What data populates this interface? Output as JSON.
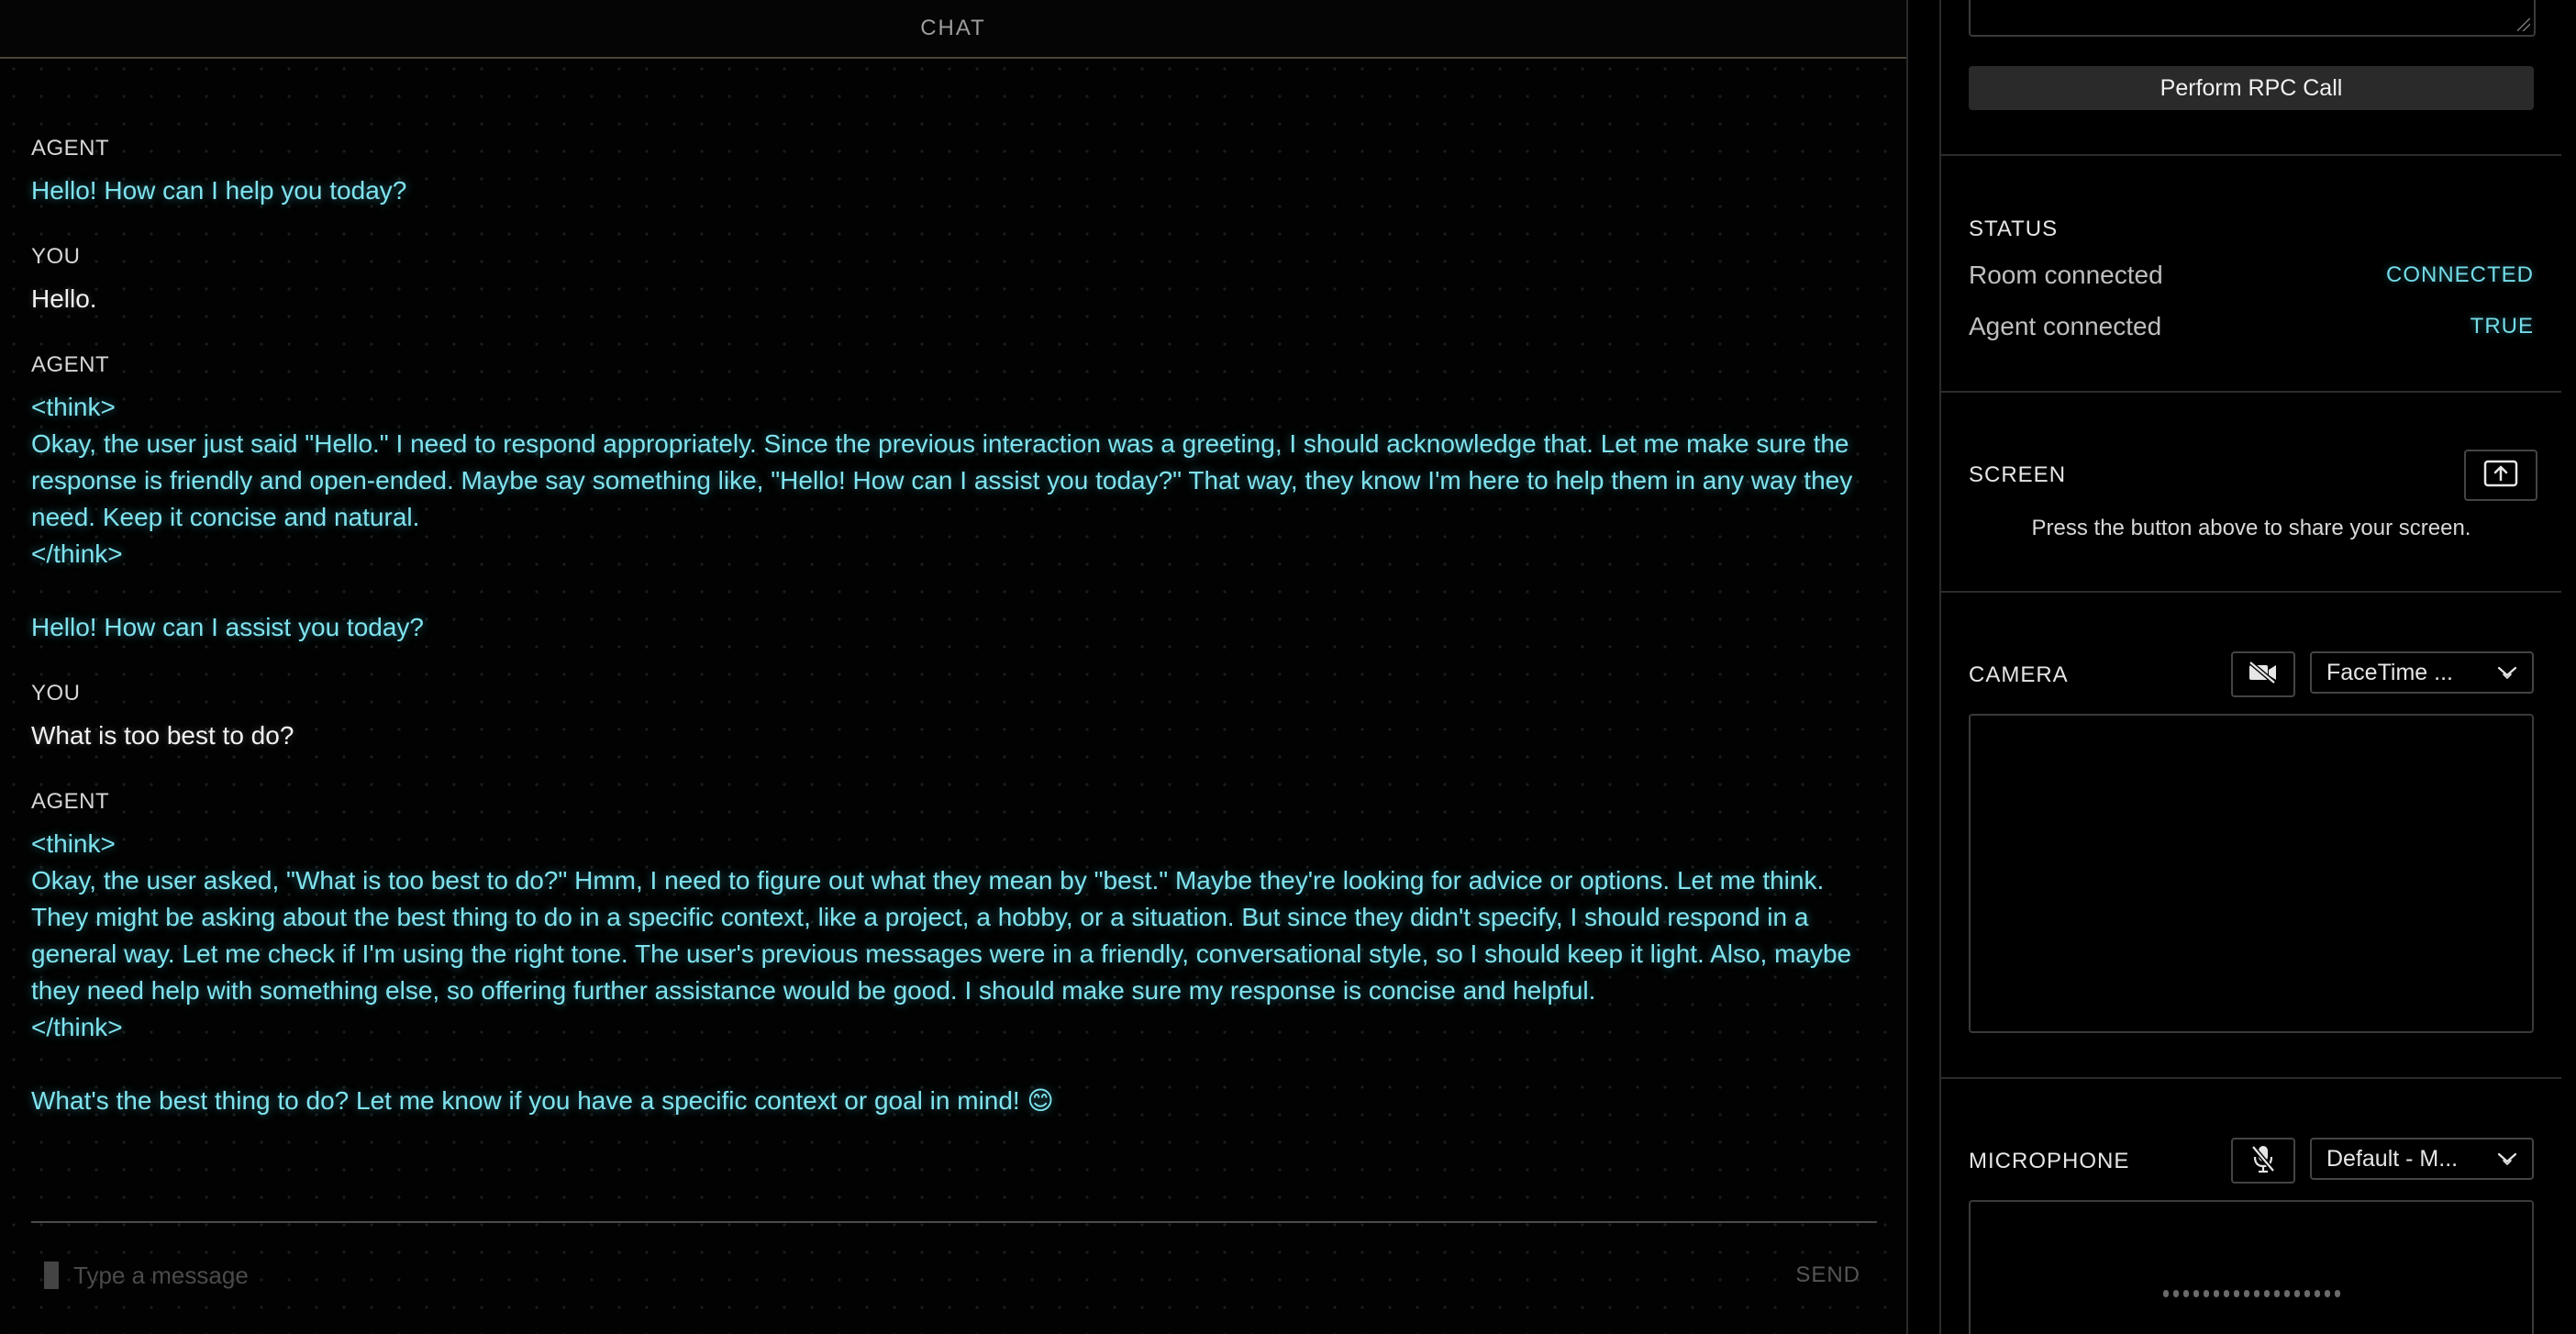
{
  "chat": {
    "header": "CHAT",
    "messages": [
      {
        "role": "agent",
        "name": "AGENT",
        "text": "Hello! How can I help you today?"
      },
      {
        "role": "you",
        "name": "YOU",
        "text": "Hello."
      },
      {
        "role": "agent",
        "name": "AGENT",
        "text": "<think>\nOkay, the user just said \"Hello.\" I need to respond appropriately. Since the previous interaction was a greeting, I should acknowledge that. Let me make sure the response is friendly and open-ended. Maybe say something like, \"Hello! How can I assist you today?\" That way, they know I'm here to help them in any way they need. Keep it concise and natural.\n</think>\n\nHello! How can I assist you today?"
      },
      {
        "role": "you",
        "name": "YOU",
        "text": "What is too best to do?"
      },
      {
        "role": "agent",
        "name": "AGENT",
        "text": "<think>\nOkay, the user asked, \"What is too best to do?\" Hmm, I need to figure out what they mean by \"best.\" Maybe they're looking for advice or options. Let me think. They might be asking about the best thing to do in a specific context, like a project, a hobby, or a situation. But since they didn't specify, I should respond in a general way. Let me check if I'm using the right tone. The user's previous messages were in a friendly, conversational style, so I should keep it light. Also, maybe they need help with something else, so offering further assistance would be good. I should make sure my response is concise and helpful.\n</think>\n\nWhat's the best thing to do? Let me know if you have a specific context or goal in mind! 😊"
      }
    ],
    "input_placeholder": "Type a message",
    "send_label": "SEND"
  },
  "rpc": {
    "button_label": "Perform RPC Call"
  },
  "status": {
    "title": "STATUS",
    "room_label": "Room connected",
    "room_value": "CONNECTED",
    "agent_label": "Agent connected",
    "agent_value": "TRUE"
  },
  "screen": {
    "title": "SCREEN",
    "hint": "Press the button above to share your screen.",
    "share_icon": "screen-share-icon"
  },
  "camera": {
    "title": "CAMERA",
    "device": "FaceTime ...",
    "toggle_icon": "camera-off-icon"
  },
  "microphone": {
    "title": "MICROPHONE",
    "device": "Default - M...",
    "toggle_icon": "microphone-off-icon",
    "level_dots": 18
  },
  "colors": {
    "agent_text": "#7fe3ee",
    "user_text": "#f2f2f2",
    "status_value": "#74dbe7",
    "background": "#000000"
  }
}
